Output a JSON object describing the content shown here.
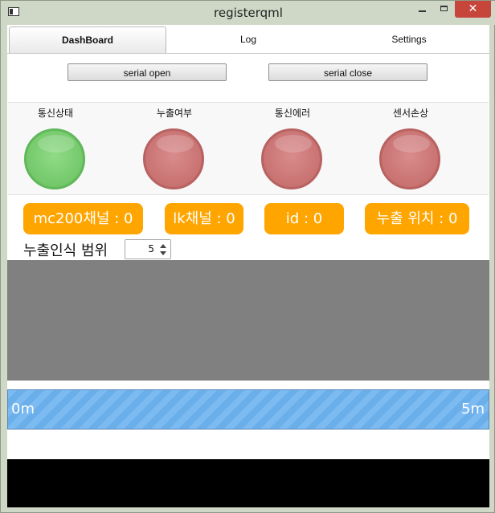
{
  "window": {
    "title": "registerqml",
    "close_glyph": "✕"
  },
  "tabs": [
    {
      "label": "DashBoard",
      "active": true
    },
    {
      "label": "Log",
      "active": false
    },
    {
      "label": "Settings",
      "active": false
    }
  ],
  "serial": {
    "open_label": "serial open",
    "close_label": "serial close"
  },
  "indicators": [
    {
      "label": "통신상태",
      "state": "green"
    },
    {
      "label": "누출여부",
      "state": "red"
    },
    {
      "label": "통신에러",
      "state": "red"
    },
    {
      "label": "센서손상",
      "state": "red"
    }
  ],
  "badges": {
    "mc200": "mc200채널 : 0",
    "lk": "lk채널 : 0",
    "id": "id : 0",
    "position": "누출 위치 : 0"
  },
  "range": {
    "label": "누출인식 범위",
    "value": "5"
  },
  "progress": {
    "min_label": "0m",
    "max_label": "5m",
    "fraction": 1.0
  },
  "colors": {
    "badge": "#ffa500",
    "led_green": "#74c86a",
    "led_red": "#c97272",
    "display": "#808080",
    "progress": "#7cbaf2",
    "close_button": "#c7463c"
  },
  "icons": [
    "app-window-icon",
    "minimize-icon",
    "maximize-icon",
    "close-icon",
    "spin-up-arrow-icon",
    "spin-down-arrow-icon"
  ]
}
